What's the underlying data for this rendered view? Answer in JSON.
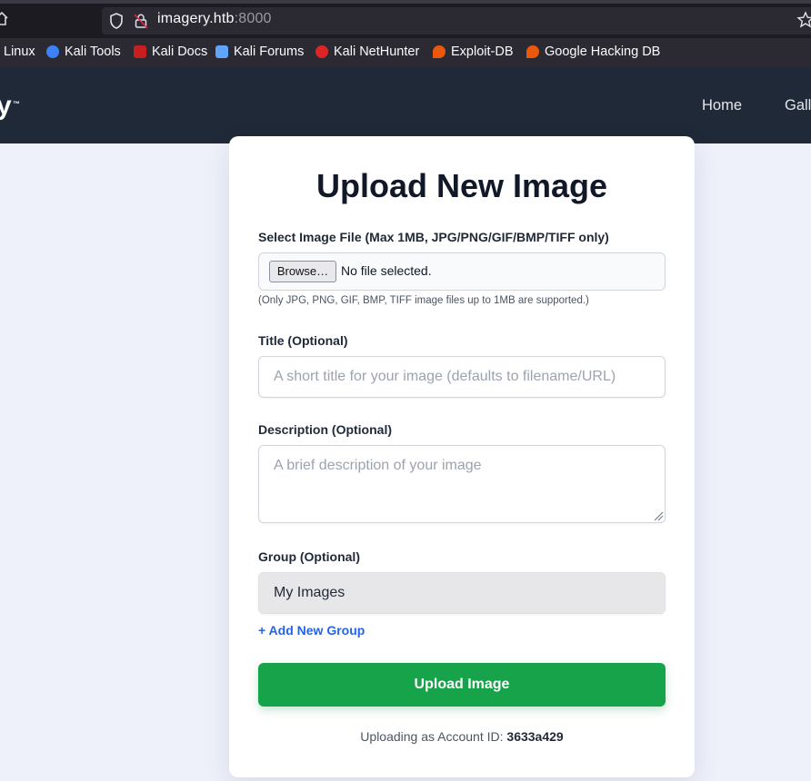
{
  "browser": {
    "url_host": "imagery.htb",
    "url_port": ":8000",
    "bookmarks": [
      {
        "label": "Linux",
        "icon": "kali-linux-icon"
      },
      {
        "label": "Kali Tools",
        "icon": "kali-tools-icon"
      },
      {
        "label": "Kali Docs",
        "icon": "kali-docs-icon"
      },
      {
        "label": "Kali Forums",
        "icon": "kali-forums-icon"
      },
      {
        "label": "Kali NetHunter",
        "icon": "kali-nethunter-icon"
      },
      {
        "label": "Exploit-DB",
        "icon": "exploit-db-icon"
      },
      {
        "label": "Google Hacking DB",
        "icon": "ghdb-icon"
      }
    ]
  },
  "site": {
    "logo_fragment": "y",
    "logo_tm": "™",
    "nav": {
      "home": "Home",
      "gallery_fragment": "Gall"
    }
  },
  "form": {
    "title": "Upload New Image",
    "file_label": "Select Image File (Max 1MB, JPG/PNG/GIF/BMP/TIFF only)",
    "browse_label": "Browse…",
    "file_status": "No file selected.",
    "file_hint": "(Only JPG, PNG, GIF, BMP, TIFF image files up to 1MB are supported.)",
    "title_label": "Title (Optional)",
    "title_placeholder": "A short title for your image (defaults to filename/URL)",
    "description_label": "Description (Optional)",
    "description_placeholder": "A brief description of your image",
    "group_label": "Group (Optional)",
    "group_selected": "My Images",
    "add_group_label": "+ Add New Group",
    "upload_button": "Upload Image",
    "account_prefix": "Uploading as Account ID: ",
    "account_id": "3633a429"
  },
  "colors": {
    "header_bg": "#1f2937",
    "upload_green": "#16a34a",
    "link_blue": "#2563eb",
    "page_bg": "#eef0fa"
  }
}
